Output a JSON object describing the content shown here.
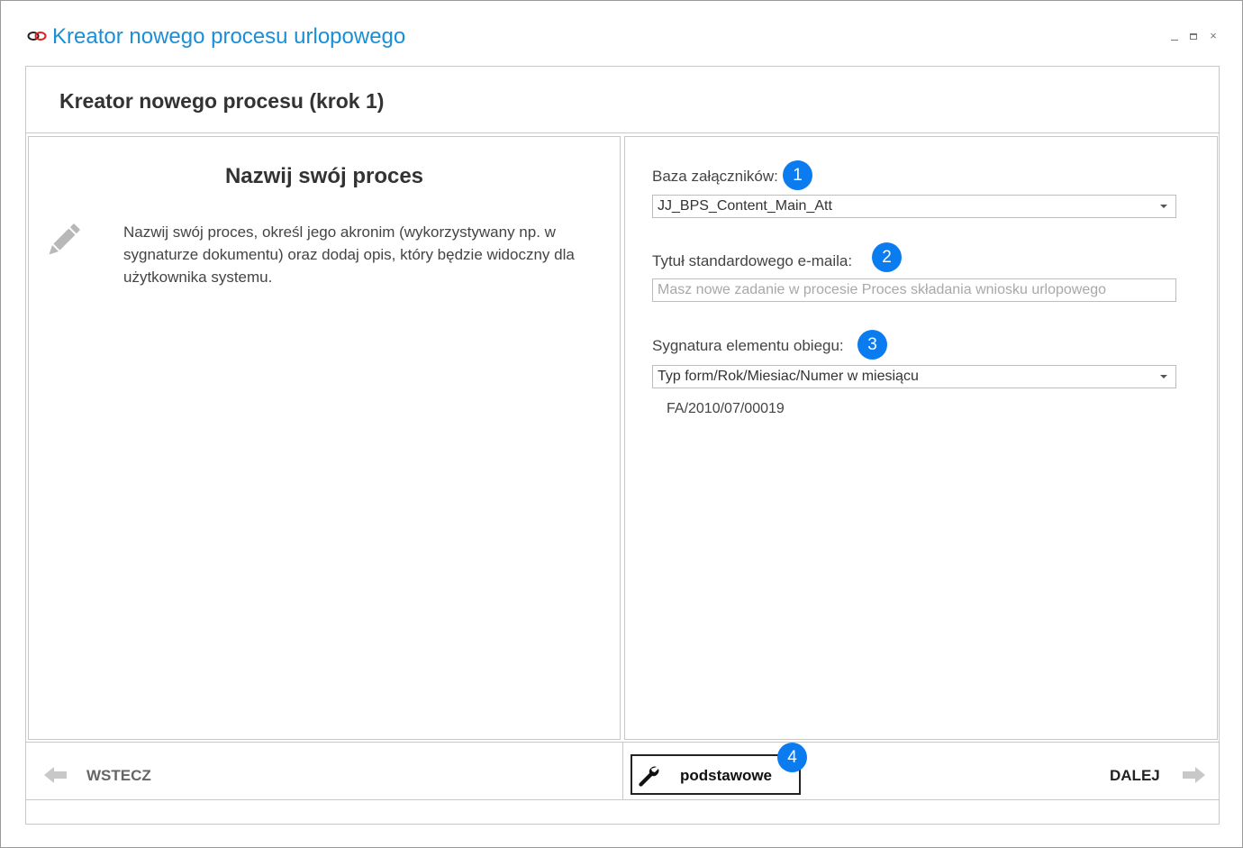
{
  "window": {
    "title": "Kreator nowego procesu urlopowego",
    "icon": "chain-link-icon",
    "controls": [
      "minimize",
      "maximize",
      "close"
    ],
    "close_glyph": "×"
  },
  "step": {
    "title": "Kreator nowego procesu (krok 1)"
  },
  "left_panel": {
    "title": "Nazwij swój proces",
    "icon": "pencil-icon",
    "description": "Nazwij swój proces, określ jego akronim (wykorzystywany np. w sygnaturze dokumentu) oraz dodaj opis, który będzie widoczny dla użytkownika systemu."
  },
  "fields": {
    "attachments_db": {
      "label": "Baza załączników:",
      "badge": "1",
      "value": "JJ_BPS_Content_Main_Att"
    },
    "email_title": {
      "label": "Tytuł standardowego e-maila:",
      "badge": "2",
      "value": "",
      "placeholder": "Masz nowe zadanie w procesie Proces składania wniosku urlopowego"
    },
    "signature": {
      "label": "Sygnatura elementu obiegu:",
      "badge": "3",
      "value": "Typ form/Rok/Miesiac/Numer w miesiącu",
      "preview": "FA/2010/07/00019"
    }
  },
  "footer": {
    "back_label": "WSTECZ",
    "mode_label": "podstawowe",
    "mode_badge": "4",
    "next_label": "DALEJ"
  },
  "colors": {
    "title_accent": "#1a8fd8",
    "badge": "#0a7cf0",
    "border": "#c8c8c8"
  }
}
